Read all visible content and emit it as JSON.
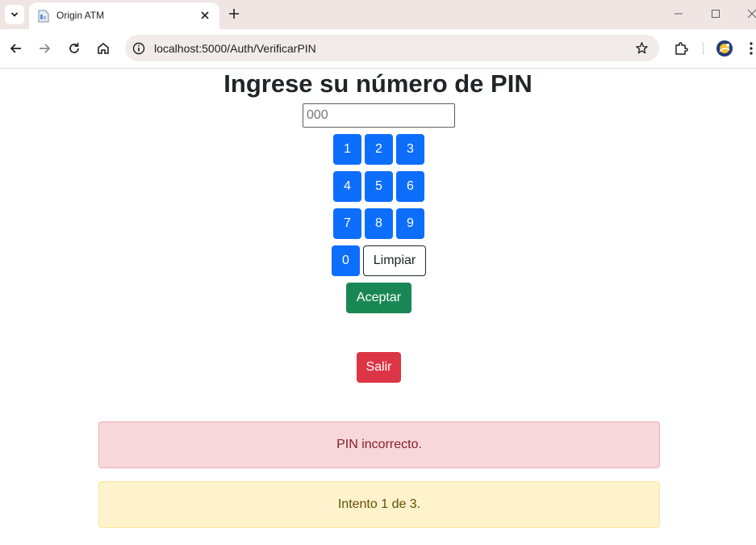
{
  "browser": {
    "tab_title": "Origin ATM",
    "url": "localhost:5000/Auth/VerificarPIN",
    "icons": [
      "tab-search-icon",
      "favicon-icon",
      "close-icon",
      "plus-icon",
      "minimize-icon",
      "maximize-icon",
      "window-close-icon",
      "back-icon",
      "forward-icon",
      "reload-icon",
      "home-icon",
      "info-icon",
      "star-icon",
      "extensions-icon",
      "profile-icon",
      "menu-icon"
    ]
  },
  "page": {
    "title": "Ingrese su número de PIN",
    "pin_placeholder": "000",
    "keypad": [
      "1",
      "2",
      "3",
      "4",
      "5",
      "6",
      "7",
      "8",
      "9",
      "0"
    ],
    "clear_label": "Limpiar",
    "accept_label": "Aceptar",
    "exit_label": "Salir",
    "error_message": "PIN incorrecto.",
    "attempt_message": "Intento 1 de 3."
  },
  "colors": {
    "primary": "#0d6efd",
    "success": "#198754",
    "danger": "#dc3545",
    "alert_danger_bg": "#f8d7da",
    "alert_warning_bg": "#fff3cd"
  }
}
